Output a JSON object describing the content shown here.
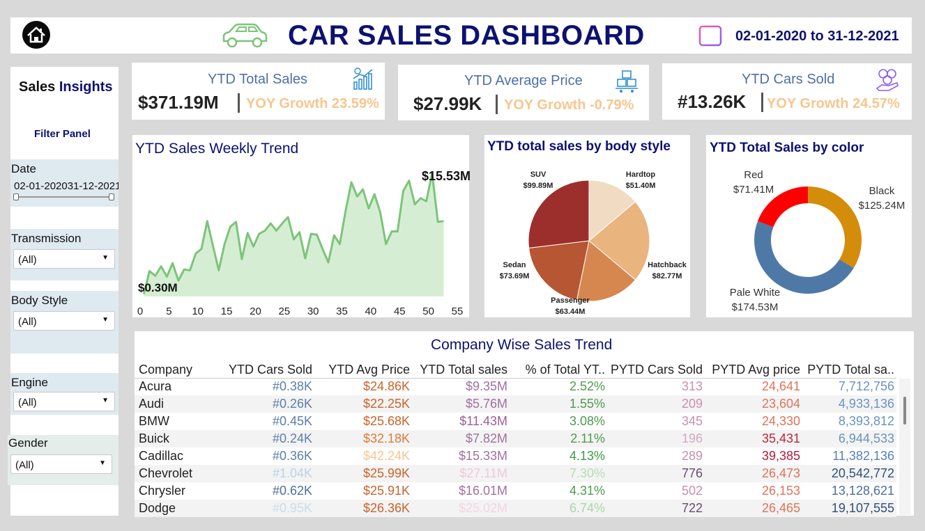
{
  "header": {
    "title": "CAR SALES DASHBOARD",
    "date_range": "02-01-2020  to 31-12-2021"
  },
  "sidebar": {
    "title_part1": "Sales",
    "title_part2": "Insights",
    "filter_panel": "Filter Panel",
    "date_label": "Date",
    "date_start": "02-01-2020",
    "date_end": "31-12-2021",
    "filters": [
      {
        "label": "Transmission",
        "value": "(All)"
      },
      {
        "label": "Body Style",
        "value": "(All)"
      },
      {
        "label": "Engine",
        "value": "(All)"
      },
      {
        "label": "Gender",
        "value": "(All)"
      }
    ]
  },
  "kpis": [
    {
      "title": "YTD Total Sales",
      "value": "$371.19M",
      "growth": "YOY Growth 23.59%",
      "icon": "sales-chart-icon"
    },
    {
      "title": "YTD Average Price",
      "value": "$27.99K",
      "growth": "YOY Growth -0.79%",
      "icon": "boxes-cart-icon"
    },
    {
      "title": "YTD Cars Sold",
      "value": "#13.26K",
      "growth": "YOY Growth 24.57%",
      "icon": "coins-hand-icon"
    }
  ],
  "weekly_trend": {
    "title": "YTD Sales Weekly Trend",
    "min_label": "$0.30M",
    "max_label": "$15.53M",
    "x_ticks": [
      "0",
      "5",
      "10",
      "15",
      "20",
      "25",
      "30",
      "35",
      "40",
      "45",
      "50",
      "55"
    ]
  },
  "body_style": {
    "title": "YTD total sales by body style",
    "labels": [
      {
        "name": "SUV",
        "value": "$99.89M"
      },
      {
        "name": "Hardtop",
        "value": "$51.40M"
      },
      {
        "name": "Hatchback",
        "value": "$82.77M"
      },
      {
        "name": "Passenger",
        "value": "$63.44M"
      },
      {
        "name": "Sedan",
        "value": "$73.69M"
      }
    ]
  },
  "color_sales": {
    "title": "YTD Total Sales by color",
    "labels": [
      {
        "name": "Red",
        "value": "$71.41M"
      },
      {
        "name": "Black",
        "value": "$125.24M"
      },
      {
        "name": "Pale White",
        "value": "$174.53M"
      }
    ]
  },
  "table": {
    "title": "Company Wise Sales Trend",
    "columns": [
      "Company",
      "YTD Cars Sold",
      "YTD Avg Price",
      "YTD Total sales",
      "% of Total YT..",
      "PYTD Cars Sold",
      "PYTD Avg price",
      "PYTD Total sa.."
    ],
    "rows": [
      [
        "Acura",
        "#0.38K",
        "$24.86K",
        "$9.35M",
        "2.52%",
        "313",
        "24,641",
        "7,712,756"
      ],
      [
        "Audi",
        "#0.26K",
        "$22.25K",
        "$5.76M",
        "1.55%",
        "209",
        "23,604",
        "4,933,136"
      ],
      [
        "BMW",
        "#0.45K",
        "$25.68K",
        "$11.43M",
        "3.08%",
        "345",
        "24,330",
        "8,393,812"
      ],
      [
        "Buick",
        "#0.24K",
        "$32.18K",
        "$7.82M",
        "2.11%",
        "196",
        "35,431",
        "6,944,533"
      ],
      [
        "Cadillac",
        "#0.36K",
        "$42.24K",
        "$15.33M",
        "4.13%",
        "289",
        "39,385",
        "11,382,136"
      ],
      [
        "Chevrolet",
        "#1.04K",
        "$25.99K",
        "$27.11M",
        "7.30%",
        "776",
        "26,473",
        "20,542,772"
      ],
      [
        "Chrysler",
        "#0.62K",
        "$25.91K",
        "$16.01M",
        "4.31%",
        "502",
        "26,153",
        "13,128,621"
      ],
      [
        "Dodge",
        "#0.95K",
        "$26.36K",
        "$25.02M",
        "6.74%",
        "722",
        "26,465",
        "19,107,555"
      ]
    ],
    "cell_colors": [
      [
        "#222222",
        "#5b7fa8",
        "#c8642c",
        "#a0709e",
        "#4f9a4f",
        "#c98fb0",
        "#e0735a",
        "#6a93c0"
      ],
      [
        "#222222",
        "#5b7fa8",
        "#c8642c",
        "#a0709e",
        "#4f9a4f",
        "#c98fb0",
        "#e0735a",
        "#6a93c0"
      ],
      [
        "#222222",
        "#5b7fa8",
        "#c8642c",
        "#9a5f98",
        "#4f9a4f",
        "#c98fb0",
        "#e0735a",
        "#6a93c0"
      ],
      [
        "#222222",
        "#5b7fa8",
        "#e07a3a",
        "#a0709e",
        "#4f9a4f",
        "#d4a8c4",
        "#c0243c",
        "#6a93c0"
      ],
      [
        "#222222",
        "#5b7fa8",
        "#f7c58f",
        "#a0709e",
        "#3e9a3e",
        "#c98fb0",
        "#b31b3b",
        "#5580b8"
      ],
      [
        "#222222",
        "#b8d4e6",
        "#c8642c",
        "#f0c8dc",
        "#b8dcb4",
        "#6a4a70",
        "#e0735a",
        "#2f4f7a"
      ],
      [
        "#222222",
        "#4f6f98",
        "#c8642c",
        "#a0709e",
        "#4f9a4f",
        "#c98fb0",
        "#e0735a",
        "#4a6f9f"
      ],
      [
        "#222222",
        "#c8dcec",
        "#c8642c",
        "#f4d4e4",
        "#a8d8a4",
        "#6a4a70",
        "#e0735a",
        "#2f4f7a"
      ]
    ]
  },
  "chart_data": [
    {
      "type": "area",
      "title": "YTD Sales Weekly Trend",
      "x": [
        1,
        2,
        3,
        4,
        5,
        6,
        7,
        8,
        9,
        10,
        11,
        12,
        13,
        14,
        15,
        16,
        17,
        18,
        19,
        20,
        21,
        22,
        23,
        24,
        25,
        26,
        27,
        28,
        29,
        30,
        31,
        32,
        33,
        34,
        35,
        36,
        37,
        38,
        39,
        40,
        41,
        42,
        43,
        44,
        45,
        46,
        47,
        48,
        49,
        50,
        51,
        52,
        53
      ],
      "values": [
        0.3,
        3.2,
        2.6,
        3.8,
        2.5,
        4.2,
        2.0,
        3.4,
        3.3,
        5.4,
        6.0,
        9.5,
        6.4,
        3.3,
        6.6,
        8.8,
        9.4,
        4.7,
        8.0,
        6.3,
        7.9,
        8.3,
        9.2,
        8.3,
        9.2,
        10.0,
        7.2,
        8.1,
        4.8,
        7.9,
        7.8,
        6.0,
        4.3,
        7.7,
        6.6,
        10.8,
        14.4,
        12.6,
        13.5,
        11.1,
        12.9,
        10.6,
        6.6,
        8.2,
        8.2,
        13.3,
        14.6,
        11.6,
        12.4,
        12.0,
        15.53,
        9.4,
        9.5
      ],
      "xlim": [
        0,
        55
      ]
    },
    {
      "type": "pie",
      "title": "YTD total sales by body style",
      "categories": [
        "Hardtop",
        "Hatchback",
        "Passenger",
        "Sedan",
        "SUV"
      ],
      "values": [
        51.4,
        82.77,
        63.44,
        73.69,
        99.89
      ],
      "colors": [
        "#f1dcc3",
        "#e9b47e",
        "#d6874f",
        "#b65632",
        "#9c2f2c"
      ]
    },
    {
      "type": "pie",
      "title": "YTD Total Sales by color",
      "categories": [
        "Black",
        "Pale White",
        "Red"
      ],
      "values": [
        125.24,
        174.53,
        71.41
      ],
      "colors": [
        "#d38d0a",
        "#4e79a7",
        "#ff0000"
      ]
    }
  ]
}
